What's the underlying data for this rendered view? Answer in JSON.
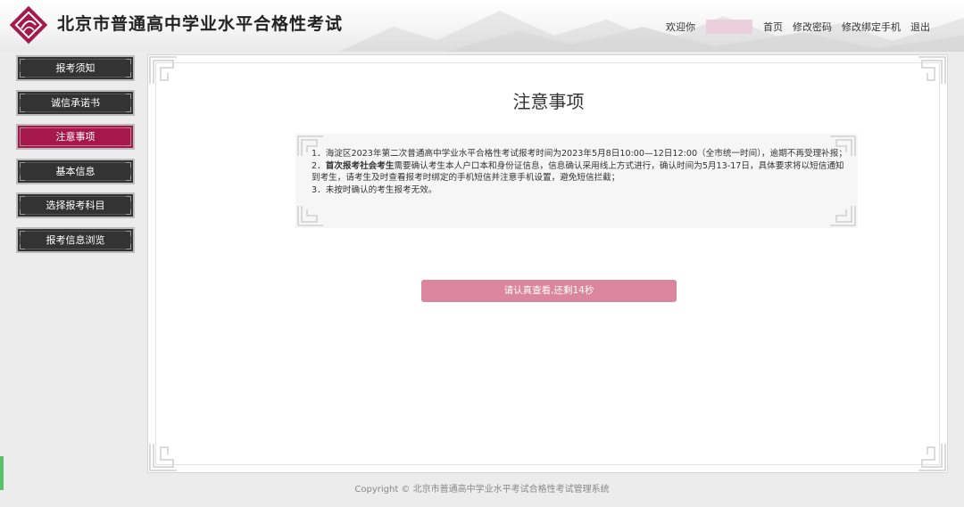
{
  "header": {
    "site_title": "北京市普通高中学业水平合格性考试",
    "welcome": "欢迎你",
    "nav": [
      "首页",
      "修改密码",
      "修改绑定手机",
      "退出"
    ]
  },
  "sidebar": {
    "items": [
      {
        "label": "报考须知",
        "active": false
      },
      {
        "label": "诚信承诺书",
        "active": false
      },
      {
        "label": "注意事项",
        "active": true
      },
      {
        "label": "基本信息",
        "active": false
      },
      {
        "label": "选择报考科目",
        "active": false
      },
      {
        "label": "报考信息浏览",
        "active": false
      }
    ]
  },
  "main": {
    "title": "注意事项",
    "notice": {
      "item1": "1．海淀区2023年第二次普通高中学业水平合格性考试报考时间为2023年5月8日10:00—12日12:00（全市统一时间），逾期不再受理补报；",
      "item2_prefix": "2．",
      "item2_bold": "首次报考社会考生",
      "item2_rest": "需要确认考生本人户口本和身份证信息，信息确认采用线上方式进行，确认时间为5月13-17日，具体要求将以短信通知到考生，请考生及时查看报考时绑定的手机短信并注意手机设置，避免短信拦截；",
      "item3": "3．未按时确认的考生报考无效。"
    },
    "confirm_button": "请认真查看,还剩14秒"
  },
  "footer": {
    "copyright": "Copyright © 北京市普通高中学业水平考试合格性考试管理系统"
  },
  "colors": {
    "accent": "#a5194a",
    "button_disabled": "#d9869e",
    "sidebar_bg": "#333333"
  }
}
